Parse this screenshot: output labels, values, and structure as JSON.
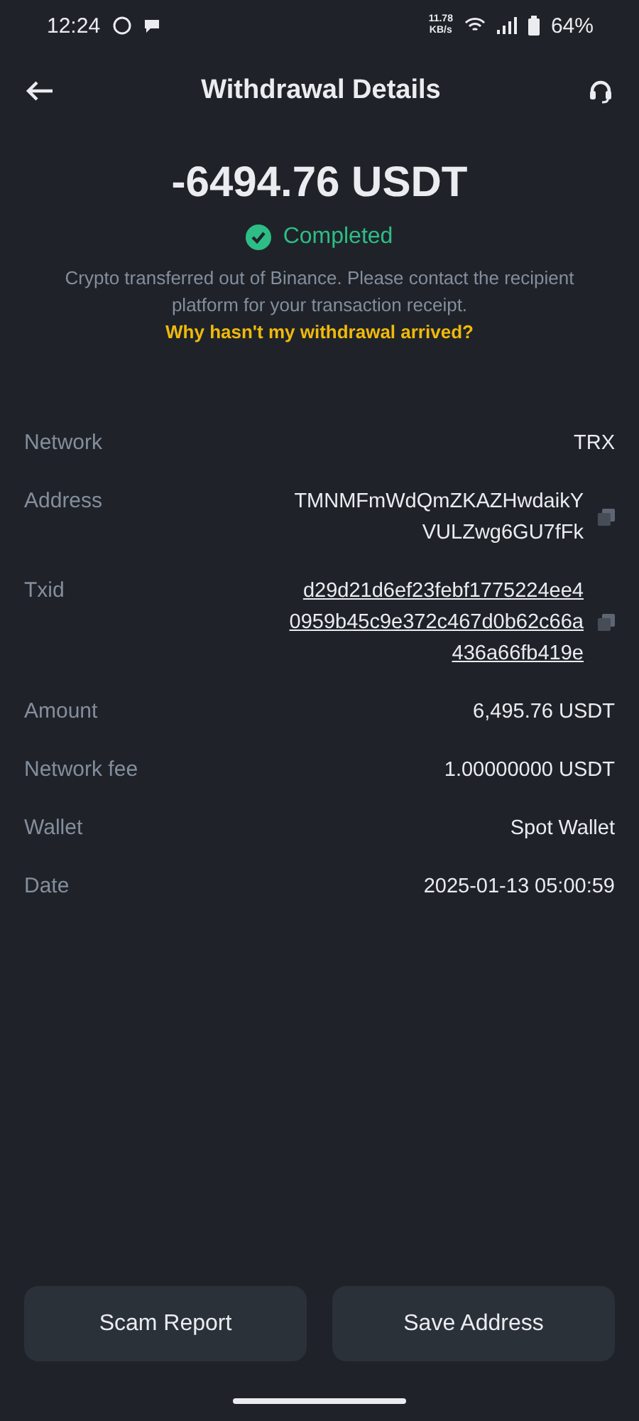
{
  "status_bar": {
    "time": "12:24",
    "speed": "11.78",
    "speed_unit": "KB/s",
    "battery": "64%"
  },
  "header": {
    "title": "Withdrawal Details"
  },
  "summary": {
    "amount": "-6494.76 USDT",
    "status": "Completed",
    "completed": true,
    "note": "Crypto transferred out of Binance. Please contact the recipient platform for your transaction receipt.",
    "link": "Why hasn't my withdrawal arrived?"
  },
  "details": [
    {
      "label": "Network",
      "lines": [
        "TRX"
      ],
      "kind": "plain"
    },
    {
      "label": "Address",
      "lines": [
        "TMNMFmWdQmZKAZHwdaikY",
        "VULZwg6GU7fFk"
      ],
      "kind": "copy"
    },
    {
      "label": "Txid",
      "lines": [
        "d29d21d6ef23febf1775224ee4",
        "0959b45c9e372c467d0b62c66a",
        "436a66fb419e"
      ],
      "kind": "link"
    },
    {
      "label": "Amount",
      "lines": [
        "6,495.76 USDT"
      ],
      "kind": "plain"
    },
    {
      "label": "Network fee",
      "lines": [
        "1.00000000 USDT"
      ],
      "kind": "plain"
    },
    {
      "label": "Wallet",
      "lines": [
        "Spot Wallet"
      ],
      "kind": "plain"
    },
    {
      "label": "Date",
      "lines": [
        "2025-01-13 05:00:59"
      ],
      "kind": "plain"
    }
  ],
  "buttons": [
    "Scam Report",
    "Save Address"
  ]
}
